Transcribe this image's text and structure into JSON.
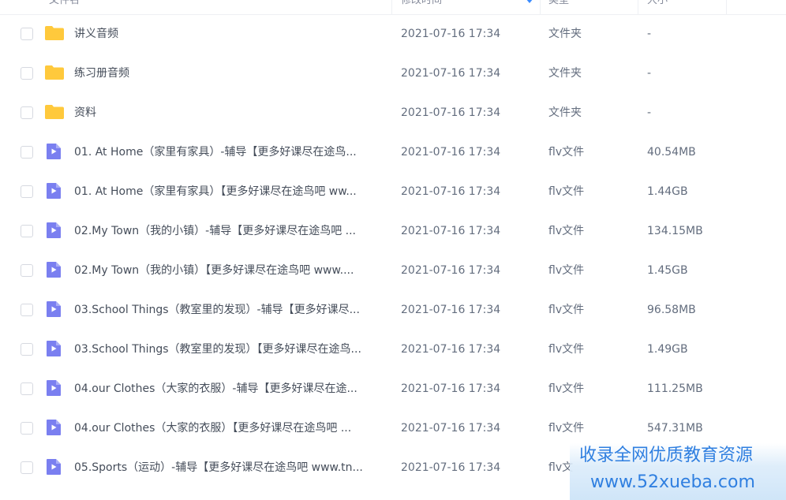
{
  "header": {
    "name": "文件名",
    "time": "修改时间",
    "type": "类型",
    "size": "大小"
  },
  "rows": [
    {
      "icon": "folder-icon",
      "name": "讲义音频",
      "time": "2021-07-16 17:34",
      "type": "文件夹",
      "size": "-"
    },
    {
      "icon": "folder-icon",
      "name": "练习册音频",
      "time": "2021-07-16 17:34",
      "type": "文件夹",
      "size": "-"
    },
    {
      "icon": "folder-icon",
      "name": "资料",
      "time": "2021-07-16 17:34",
      "type": "文件夹",
      "size": "-"
    },
    {
      "icon": "video-file-icon",
      "name": "01. At Home（家里有家具）-辅导【更多好课尽在途鸟...",
      "time": "2021-07-16 17:34",
      "type": "flv文件",
      "size": "40.54MB"
    },
    {
      "icon": "video-file-icon",
      "name": "01. At Home（家里有家具）【更多好课尽在途鸟吧 ww...",
      "time": "2021-07-16 17:34",
      "type": "flv文件",
      "size": "1.44GB"
    },
    {
      "icon": "video-file-icon",
      "name": "02.My Town（我的小镇）-辅导【更多好课尽在途鸟吧 ...",
      "time": "2021-07-16 17:34",
      "type": "flv文件",
      "size": "134.15MB"
    },
    {
      "icon": "video-file-icon",
      "name": "02.My Town（我的小镇）【更多好课尽在途鸟吧 www....",
      "time": "2021-07-16 17:34",
      "type": "flv文件",
      "size": "1.45GB"
    },
    {
      "icon": "video-file-icon",
      "name": "03.School Things（教室里的发现）-辅导【更多好课尽...",
      "time": "2021-07-16 17:34",
      "type": "flv文件",
      "size": "96.58MB"
    },
    {
      "icon": "video-file-icon",
      "name": "03.School Things（教室里的发现）【更多好课尽在途鸟...",
      "time": "2021-07-16 17:34",
      "type": "flv文件",
      "size": "1.49GB"
    },
    {
      "icon": "video-file-icon",
      "name": "04.our Clothes（大家的衣服）-辅导【更多好课尽在途...",
      "time": "2021-07-16 17:34",
      "type": "flv文件",
      "size": "111.25MB"
    },
    {
      "icon": "video-file-icon",
      "name": "04.our Clothes（大家的衣服）【更多好课尽在途鸟吧 ...",
      "time": "2021-07-16 17:34",
      "type": "flv文件",
      "size": "547.31MB"
    },
    {
      "icon": "video-file-icon",
      "name": "05.Sports（运动）-辅导【更多好课尽在途鸟吧 www.tn...",
      "time": "2021-07-16 17:34",
      "type": "flv文",
      "size": ""
    }
  ],
  "watermark": {
    "line1": "收录全网优质教育资源",
    "line2": "www.52xueba.com"
  },
  "colors": {
    "folder": "#ffc93c",
    "video": "#7a7ff0",
    "sort_accent": "#3b8cff",
    "watermark_text": "#2f7fe0"
  }
}
